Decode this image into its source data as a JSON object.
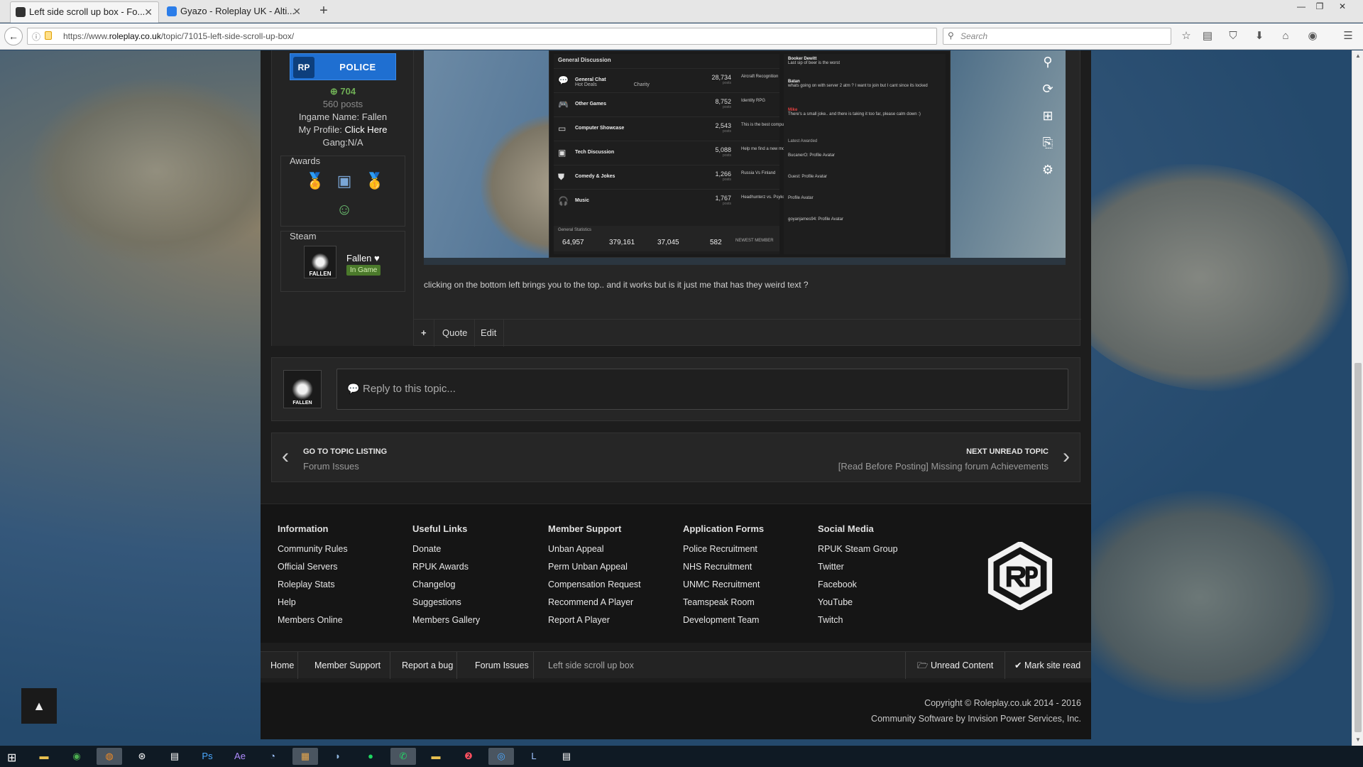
{
  "browser": {
    "tabs": [
      {
        "title": "Left side scroll up box - Fo...",
        "active": true
      },
      {
        "title": "Gyazo - Roleplay UK - Alti...",
        "active": false
      }
    ],
    "url_prefix": "https://www.",
    "url_domain": "roleplay.co.uk",
    "url_path": "/topic/71015-left-side-scroll-up-box/",
    "search_placeholder": "Search"
  },
  "author": {
    "group": "POLICE",
    "reputation": "704",
    "posts": "560 posts",
    "ingame_label": "Ingame Name:",
    "ingame_value": "Fallen",
    "profile_label": "My Profile:",
    "profile_link": "Click Here",
    "gang": "Gang:N/A",
    "awards_title": "Awards",
    "steam_title": "Steam",
    "steam_name": "Fallen ♥",
    "steam_status": "In Game",
    "avatar_caption": "FALLEN"
  },
  "screenshot": {
    "section": "General Discussion",
    "forums": [
      {
        "name": "General Chat",
        "sub": "Hot Deals",
        "extra": "Charity",
        "count": "28,734",
        "last": "Aircraft Recognition"
      },
      {
        "name": "Other Games",
        "count": "8,752",
        "last": "Identity RPG"
      },
      {
        "name": "Computer Showcase",
        "count": "2,543",
        "last": "This is the best computer ..."
      },
      {
        "name": "Tech Discussion",
        "count": "5,088",
        "last": "Help me find a new monitor..."
      },
      {
        "name": "Comedy & Jokes",
        "count": "1,266",
        "last": "Russia Vs Finland"
      },
      {
        "name": "Music",
        "count": "1,767",
        "last": "Headhunterz vs. Psyko Punk..."
      }
    ],
    "posts_label": "posts",
    "stats_title": "General Statistics",
    "stats": [
      "64,957",
      "379,161",
      "37,045",
      "582"
    ],
    "newest_member": "NEWEST MEMBER",
    "side_entries": [
      {
        "name": "Booker Dewitt",
        "text": "Last sip of beer is the worst"
      },
      {
        "name": "Batan",
        "text": "whats going on with server 2 atm ? I want to join but I cant since its locked"
      },
      {
        "name": "Mike",
        "text": "There's a small joke.. and there is taking it too far, please calm down :)"
      }
    ],
    "latest_awarded": "Latest Awarded",
    "awarded": [
      "BucanerO: Profile Avatar",
      "Guest: Profile Avatar",
      "Profile Avatar",
      "goyanjames94: Profile Avatar"
    ]
  },
  "post_text": "clicking on the bottom left brings you to the top.. and it works but is it just me that has they weird text ?",
  "actions": {
    "plus": "+",
    "quote": "Quote",
    "edit": "Edit"
  },
  "reply": {
    "placeholder": "Reply to this topic..."
  },
  "topic_nav": {
    "prev_title": "GO TO TOPIC LISTING",
    "prev_sub": "Forum Issues",
    "next_title": "NEXT UNREAD TOPIC",
    "next_sub": "[Read Before Posting] Missing forum Achievements"
  },
  "footer": {
    "columns": [
      {
        "title": "Information",
        "links": [
          "Community Rules",
          "Official Servers",
          "Roleplay Stats",
          "Help",
          "Members Online"
        ]
      },
      {
        "title": "Useful Links",
        "links": [
          "Donate",
          "RPUK Awards",
          "Changelog",
          "Suggestions",
          "Members Gallery"
        ]
      },
      {
        "title": "Member Support",
        "links": [
          "Unban Appeal",
          "Perm Unban Appeal",
          "Compensation Request",
          "Recommend A Player",
          "Report A Player"
        ]
      },
      {
        "title": "Application Forms",
        "links": [
          "Police Recruitment",
          "NHS Recruitment",
          "UNMC Recruitment",
          "Teamspeak Room",
          "Development Team"
        ]
      },
      {
        "title": "Social Media",
        "links": [
          "RPUK Steam Group",
          "Twitter",
          "Facebook",
          "YouTube",
          "Twitch"
        ]
      }
    ]
  },
  "breadcrumb": [
    "Home",
    "Member Support",
    "Report a bug",
    "Forum Issues",
    "Left side scroll up box"
  ],
  "unread_content": "Unread Content",
  "mark_site_read": "Mark site read",
  "copyright": "Copyright © Roleplay.co.uk 2014 - 2016",
  "software": "Community Software by Invision Power Services, Inc.",
  "scroll_top": "▲",
  "colors": {
    "accent": "#1f6fd1",
    "reputation": "#6fae55",
    "background": "#1d1d1d"
  }
}
